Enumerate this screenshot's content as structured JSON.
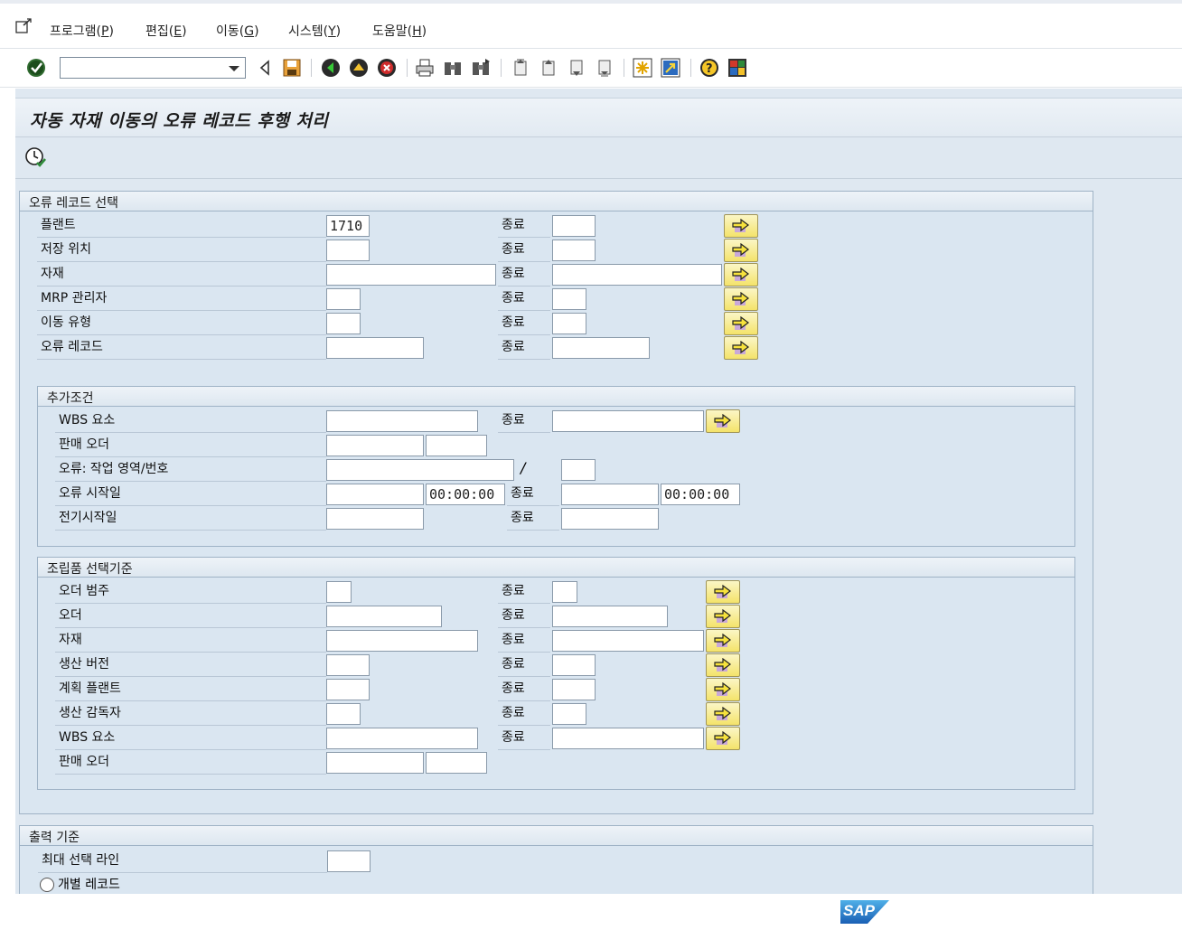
{
  "menu": {
    "items": [
      {
        "label": "프로그램(",
        "key": "P",
        "tail": ")"
      },
      {
        "label": "편집(",
        "key": "E",
        "tail": ")"
      },
      {
        "label": "이동(",
        "key": "G",
        "tail": ")"
      },
      {
        "label": "시스템(",
        "key": "Y",
        "tail": ")"
      },
      {
        "label": "도움말(",
        "key": "H",
        "tail": ")"
      }
    ]
  },
  "toolbar": {
    "command_value": "",
    "icons": [
      "enter-icon",
      "back-triangle-icon",
      "save-icon",
      "back-icon",
      "exit-icon",
      "cancel-icon",
      "print-icon",
      "find-icon",
      "find-next-icon",
      "first-page-icon",
      "prev-page-icon",
      "next-page-icon",
      "last-page-icon",
      "new-session-icon",
      "shortcut-icon",
      "help-icon",
      "layout-icon"
    ]
  },
  "page": {
    "title": "자동 자재 이동의 오류 레코드 후행 처리",
    "execute_icon": "execute-clock-icon"
  },
  "sections": {
    "error_selection": {
      "title": "오류 레코드 선택",
      "to_label": "종료",
      "rows": [
        {
          "label": "플랜트",
          "from": "1710",
          "to": ""
        },
        {
          "label": "저장 위치",
          "from": "",
          "to": ""
        },
        {
          "label": "자재",
          "from": "",
          "to": ""
        },
        {
          "label": "MRP 관리자",
          "from": "",
          "to": ""
        },
        {
          "label": "이동 유형",
          "from": "",
          "to": ""
        },
        {
          "label": "오류 레코드",
          "from": "",
          "to": ""
        }
      ]
    },
    "additional": {
      "title": "추가조건",
      "wbs_label": "WBS 요소",
      "sales_order_label": "판매 오더",
      "error_work_area_label": "오류: 작업 영역/번호",
      "slash": "/",
      "error_start_label": "오류 시작일",
      "error_start_time": "00:00:00",
      "error_end_time": "00:00:00",
      "posting_start_label": "전기시작일",
      "to_label": "종료"
    },
    "assembly": {
      "title": "조립품 선택기준",
      "to_label": "종료",
      "rows": [
        {
          "label": "오더 범주"
        },
        {
          "label": "오더"
        },
        {
          "label": "자재"
        },
        {
          "label": "생산 버전"
        },
        {
          "label": "계획 플랜트"
        },
        {
          "label": "생산 감독자"
        },
        {
          "label": "WBS 요소"
        },
        {
          "label": "판매 오더"
        }
      ]
    },
    "output": {
      "title": "출력 기준",
      "max_lines_label": "최대 선택 라인",
      "max_lines_value": "",
      "individual_records_label": "개별 레코드"
    }
  },
  "footer": {
    "logo_text": "SAP"
  },
  "colors": {
    "background": "#dfe8f1",
    "frame_border": "#9fb3c6",
    "button_yellow": "#f4e36a"
  }
}
